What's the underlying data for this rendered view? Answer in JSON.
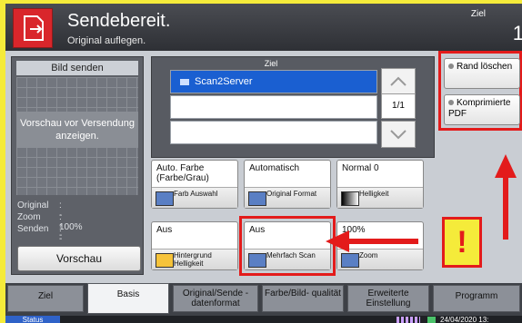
{
  "header": {
    "title": "Sendebereit.",
    "subtitle": "Original auflegen.",
    "dest_label": "Ziel",
    "dest_count": "1"
  },
  "preview": {
    "header": "Bild senden",
    "message": "Vorschau vor Versendung anzeigen.",
    "info": [
      {
        "label": "Original",
        "value": ": ---"
      },
      {
        "label": "Zoom",
        "value": ": 100%"
      },
      {
        "label": "Senden",
        "value": ": ---"
      }
    ],
    "button": "Vorschau"
  },
  "dest_list": {
    "header": "Ziel",
    "items": [
      "Scan2Server",
      "",
      ""
    ],
    "page": "1/1"
  },
  "side_buttons": [
    {
      "label": "Rand löschen"
    },
    {
      "label": "Komprimierte PDF"
    }
  ],
  "functions": [
    {
      "value": "Auto. Farbe (Farbe/Grau)",
      "label": "Farb Auswahl"
    },
    {
      "value": "Automatisch",
      "label": "Original Format"
    },
    {
      "value": "Normal 0",
      "label": "Helligkeit"
    },
    {
      "value": "Aus",
      "label": "Hintergrund Helligkeit"
    },
    {
      "value": "Aus",
      "label": "Mehrfach Scan"
    },
    {
      "value": "100%",
      "label": "Zoom"
    }
  ],
  "tabs": [
    {
      "label": "Ziel"
    },
    {
      "label": "Basis"
    },
    {
      "label": "Original/Sende -datenformat"
    },
    {
      "label": "Farbe/Bild- qualität"
    },
    {
      "label": "Erweiterte Einstellung"
    },
    {
      "label": "Programm"
    }
  ],
  "status": {
    "label": "Status",
    "date": "24/04/2020 13:"
  },
  "callout": "!",
  "colors": {
    "accent": "#e31b1b",
    "selection": "#1a5fd1",
    "home": "#d9262b"
  }
}
